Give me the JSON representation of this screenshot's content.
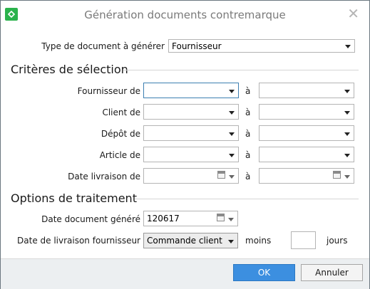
{
  "window": {
    "title": "Génération documents contremarque",
    "close_glyph": "✕",
    "app_icon": "app-logo-icon",
    "accent_color": "#2bb24c"
  },
  "doc_type": {
    "label": "Type de document à générer",
    "value": "Fournisseur"
  },
  "criteria": {
    "heading": "Critères de sélection",
    "separator": "à",
    "rows": [
      {
        "label": "Fournisseur de",
        "from": "",
        "to": ""
      },
      {
        "label": "Client de",
        "from": "",
        "to": ""
      },
      {
        "label": "Dépôt de",
        "from": "",
        "to": ""
      },
      {
        "label": "Article de",
        "from": "",
        "to": ""
      },
      {
        "label": "Date livraison de",
        "from": "",
        "to": ""
      }
    ]
  },
  "options": {
    "heading": "Options de traitement",
    "doc_date_label": "Date document généré",
    "doc_date_value": "120617",
    "supplier_date_label": "Date de livraison fournisseur",
    "supplier_date_value": "Commande client",
    "minus_label": "moins",
    "days_value": "",
    "days_label": "jours"
  },
  "footer": {
    "ok_label": "OK",
    "cancel_label": "Annuler",
    "ok_color": "#3c8fe0"
  }
}
